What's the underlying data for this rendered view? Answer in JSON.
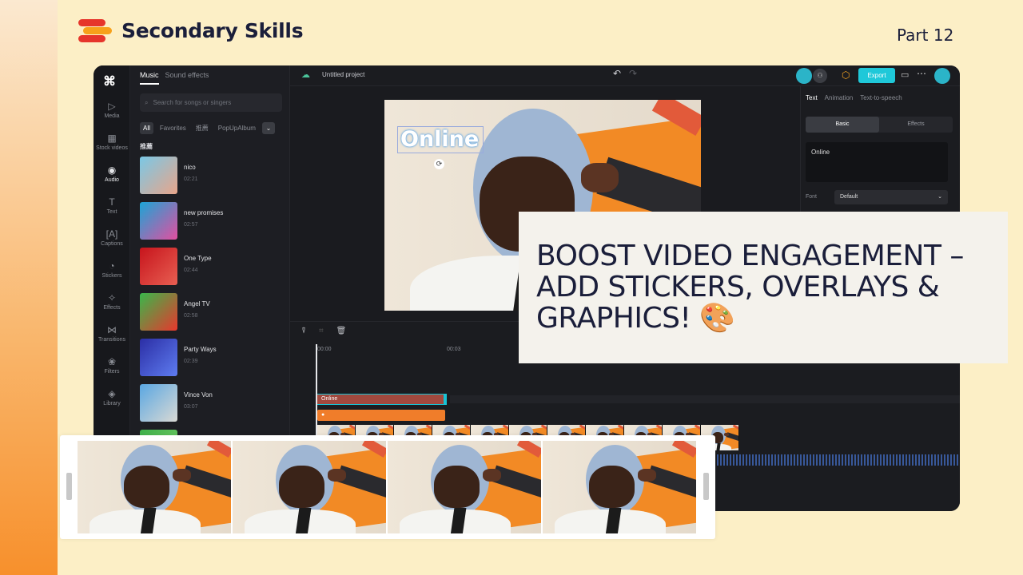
{
  "brand": {
    "name": "Secondary Skills",
    "part": "Part 12"
  },
  "app": {
    "rail": [
      {
        "label": "Media",
        "icon": "media-icon",
        "glyph": "▷",
        "active": false
      },
      {
        "label": "Stock videos",
        "icon": "stock-videos-icon",
        "glyph": "▦",
        "active": false
      },
      {
        "label": "Audio",
        "icon": "audio-icon",
        "glyph": "◉",
        "active": true
      },
      {
        "label": "Text",
        "icon": "text-icon",
        "glyph": "T",
        "active": false
      },
      {
        "label": "Captions",
        "icon": "captions-icon",
        "glyph": "[A]",
        "active": false
      },
      {
        "label": "Stickers",
        "icon": "stickers-icon",
        "glyph": "◔",
        "active": false
      },
      {
        "label": "Effects",
        "icon": "effects-icon",
        "glyph": "✧",
        "active": false
      },
      {
        "label": "Transitions",
        "icon": "transitions-icon",
        "glyph": "⋈",
        "active": false
      },
      {
        "label": "Filters",
        "icon": "filters-icon",
        "glyph": "❀",
        "active": false
      },
      {
        "label": "Library",
        "icon": "library-icon",
        "glyph": "◈",
        "active": false
      }
    ],
    "panel": {
      "tabs": [
        "Music",
        "Sound effects"
      ],
      "search_placeholder": "Search for songs or singers",
      "filters": [
        "All",
        "Favorites",
        "推薦",
        "PopUpAlbum"
      ],
      "section": "推薦",
      "tracks": [
        {
          "name": "nico",
          "duration": "02:21",
          "color1": "#7ac8e6",
          "color2": "#e8a58a"
        },
        {
          "name": "new promises",
          "duration": "02:57",
          "color1": "#1ba5d6",
          "color2": "#e24fa0"
        },
        {
          "name": "One Type",
          "duration": "02:44",
          "color1": "#c7141c",
          "color2": "#e85f52"
        },
        {
          "name": "Angel TV",
          "duration": "02:58",
          "color1": "#38b84b",
          "color2": "#e8372d"
        },
        {
          "name": "Party Ways",
          "duration": "02:39",
          "color1": "#2b2ea5",
          "color2": "#5e7cf0"
        },
        {
          "name": "Vince Von",
          "duration": "03:07",
          "color1": "#5aa7e2",
          "color2": "#d9d9d4"
        },
        {
          "name": "",
          "duration": "",
          "color1": "#3db04a",
          "color2": "#7fd16b"
        }
      ]
    },
    "topbar": {
      "project": "Untitled project",
      "export": "Export"
    },
    "preview": {
      "text": "Online"
    },
    "props": {
      "tabs": [
        "Text",
        "Animation",
        "Text-to-speech"
      ],
      "segments": [
        "Basic",
        "Effects"
      ],
      "text_value": "Online",
      "font_label": "Font",
      "font_value": "Default"
    },
    "timeline": {
      "ruler": [
        "00:00",
        "00:03"
      ],
      "text_clip": "Online"
    }
  },
  "banner": {
    "title": "BOOST VIDEO ENGAGEMENT – ADD STICKERS, OVERLAYS & GRAPHICS! 🎨"
  },
  "colors": {
    "accent": "#1fc8d9",
    "brand_red": "#e6352b",
    "brand_orange": "#f7a11a",
    "text_dark": "#1a1e3a"
  }
}
